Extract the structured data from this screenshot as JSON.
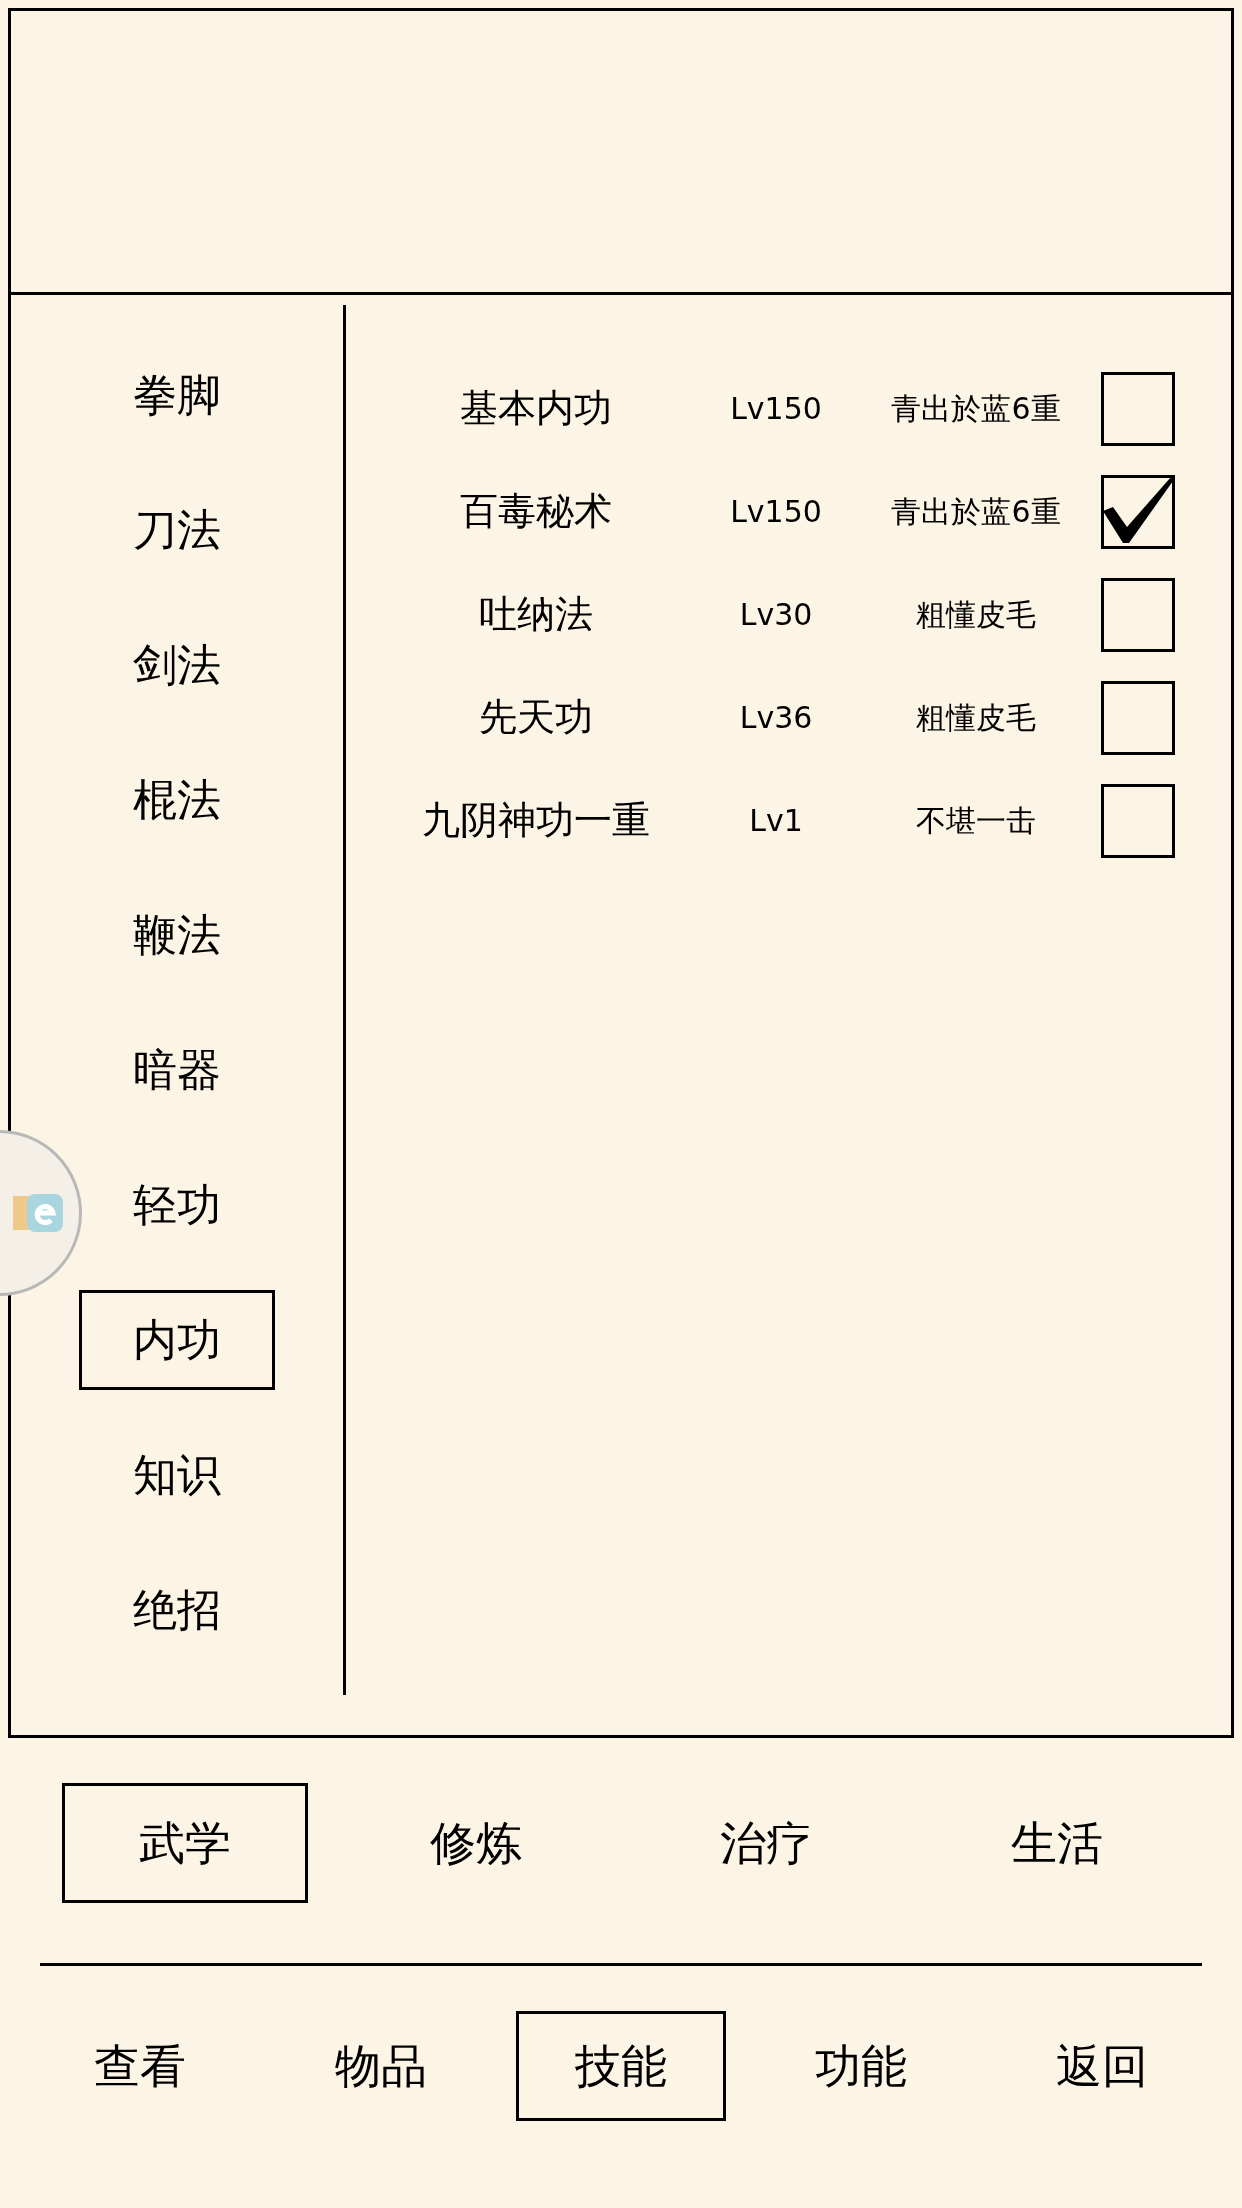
{
  "categories": [
    {
      "label": "拳脚",
      "selected": false
    },
    {
      "label": "刀法",
      "selected": false
    },
    {
      "label": "剑法",
      "selected": false
    },
    {
      "label": "棍法",
      "selected": false
    },
    {
      "label": "鞭法",
      "selected": false
    },
    {
      "label": "暗器",
      "selected": false
    },
    {
      "label": "轻功",
      "selected": false
    },
    {
      "label": "内功",
      "selected": true
    },
    {
      "label": "知识",
      "selected": false
    },
    {
      "label": "绝招",
      "selected": false
    }
  ],
  "skills": [
    {
      "name": "基本内功",
      "level": "Lv150",
      "rank": "青出於蓝6重",
      "checked": false
    },
    {
      "name": "百毒秘术",
      "level": "Lv150",
      "rank": "青出於蓝6重",
      "checked": true
    },
    {
      "name": "吐纳法",
      "level": "Lv30",
      "rank": "粗懂皮毛",
      "checked": false
    },
    {
      "name": "先天功",
      "level": "Lv36",
      "rank": "粗懂皮毛",
      "checked": false
    },
    {
      "name": "九阴神功一重",
      "level": "Lv1",
      "rank": "不堪一击",
      "checked": false
    }
  ],
  "tabs": [
    {
      "label": "武学",
      "selected": true
    },
    {
      "label": "修炼",
      "selected": false
    },
    {
      "label": "治疗",
      "selected": false
    },
    {
      "label": "生活",
      "selected": false
    }
  ],
  "nav": [
    {
      "label": "查看",
      "selected": false
    },
    {
      "label": "物品",
      "selected": false
    },
    {
      "label": "技能",
      "selected": true
    },
    {
      "label": "功能",
      "selected": false
    },
    {
      "label": "返回",
      "selected": false
    }
  ]
}
